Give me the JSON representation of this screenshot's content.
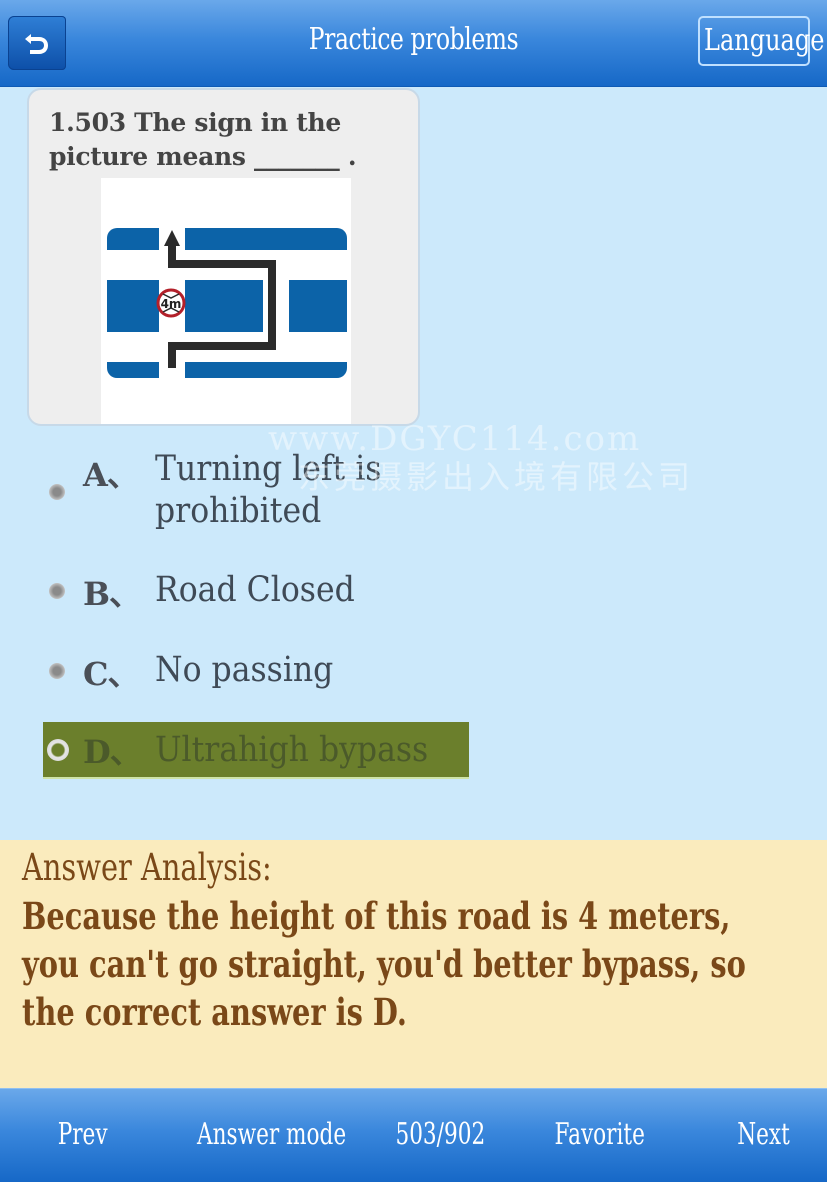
{
  "header": {
    "back_icon": "back-arrow-icon",
    "title": "Practice problems",
    "language_label": "Language"
  },
  "question": {
    "number": "1.503",
    "text": "1.503 The sign in the picture means _______ .",
    "image_alt": "Road sign: 4m height limit ahead, bypass route around the block",
    "sign_height_limit": "4m"
  },
  "watermark": {
    "line1": "www.DGYC114.com",
    "line2": "东莞摄影出入境有限公司"
  },
  "options": [
    {
      "letter": "A、",
      "text_line1": "Turning left is",
      "text_line2": "prohibited",
      "selected": false
    },
    {
      "letter": "B、",
      "text": "Road Closed",
      "selected": false
    },
    {
      "letter": "C、",
      "text": "No passing",
      "selected": false
    },
    {
      "letter": "D、",
      "text": "Ultrahigh bypass",
      "selected": true
    }
  ],
  "analysis": {
    "title": "Answer Analysis:",
    "body": "Because the height of this road is 4 meters, you can't go straight, you'd better bypass, so the correct answer is D."
  },
  "footer": {
    "prev": "Prev",
    "answer_mode": "Answer mode",
    "progress": "503/902",
    "favorite": "Favorite",
    "next": "Next"
  },
  "colors": {
    "header_blue": "#1668c7",
    "background": "#cce9fb",
    "selected_option": "#6b7f2c",
    "analysis_bg": "#faebbd",
    "analysis_text": "#7a4818",
    "sign_blue": "#0c63a8"
  }
}
